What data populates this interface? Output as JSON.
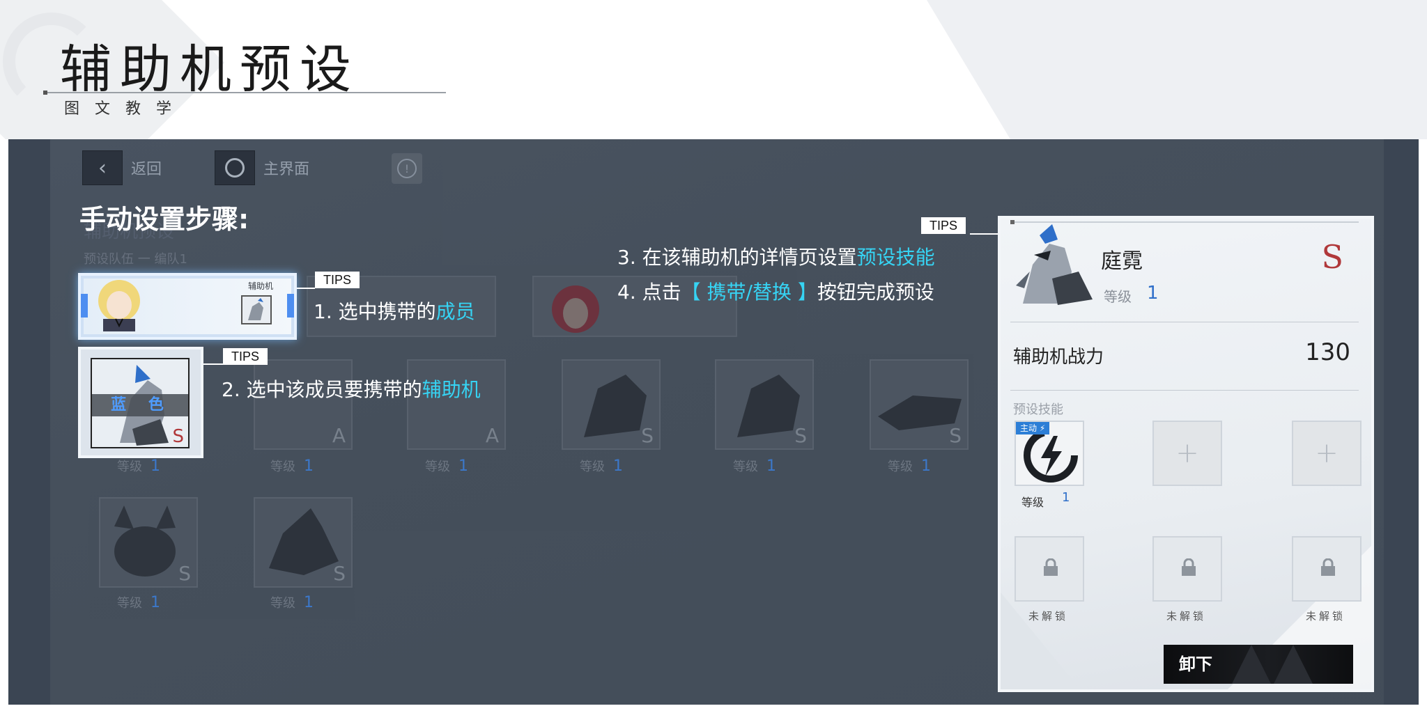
{
  "header": {
    "title": "辅助机预设",
    "subtitle": "图文教学"
  },
  "game_ui": {
    "nav": {
      "back_label": "返回",
      "home_label": "主界面"
    },
    "faded_title": "辅助机预设",
    "faded_team": "预设队伍 一 编队1",
    "member_card_tag": "辅助机",
    "selected_mech_color": "蓝 色",
    "selected_mech_grade": "S",
    "selected_mech_level_label": "等级",
    "selected_mech_level": "1",
    "mech_grid": [
      {
        "grade": "A",
        "level": "1"
      },
      {
        "grade": "A",
        "level": "1"
      },
      {
        "grade": "S",
        "level": "1"
      },
      {
        "grade": "S",
        "level": "1"
      },
      {
        "grade": "S",
        "level": "1"
      },
      {
        "grade": "S",
        "level": "1"
      },
      {
        "grade": "S",
        "level": "1"
      }
    ],
    "level_label": "等级"
  },
  "instructions": {
    "heading": "手动设置步骤:",
    "tips_label": "TIPS",
    "step1_prefix": "1. 选中携带的",
    "step1_highlight": "成员",
    "step2_prefix": "2. 选中该成员要携带的",
    "step2_highlight": "辅助机",
    "step3_prefix": "3. 在该辅助机的详情页设置",
    "step3_highlight": "预设技能",
    "step4_prefix": "4. 点击",
    "step4_highlight": "【 携带/替换 】",
    "step4_suffix": "按钮完成预设"
  },
  "detail_panel": {
    "name": "庭霓",
    "grade": "S",
    "level_label": "等级",
    "level": "1",
    "power_label": "辅助机战力",
    "power_value": "130",
    "skills_label": "预设技能",
    "active_badge": "主动",
    "skill_level_label": "等级",
    "skill_level": "1",
    "plus_symbol": "+",
    "locked_label": "未解锁",
    "unload_button": "卸下"
  },
  "colors": {
    "highlight": "#36d4f4",
    "grade_s": "#b0383a",
    "level_blue": "#2f6fc9",
    "panel_bg": "#3b4553"
  }
}
